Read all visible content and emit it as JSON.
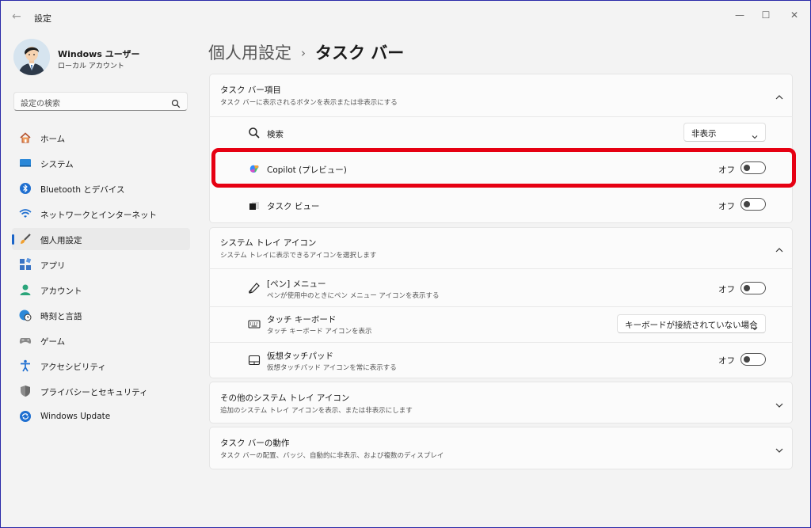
{
  "window": {
    "title": "設定",
    "back_glyph": "←",
    "min_glyph": "—",
    "max_glyph": "☐",
    "close_glyph": "✕"
  },
  "user": {
    "name": "Windows ユーザー",
    "type": "ローカル アカウント"
  },
  "search": {
    "placeholder": "設定の検索"
  },
  "sidebar": {
    "items": [
      {
        "label": "ホーム",
        "icon": "home-icon"
      },
      {
        "label": "システム",
        "icon": "system-icon"
      },
      {
        "label": "Bluetooth とデバイス",
        "icon": "bluetooth-icon"
      },
      {
        "label": "ネットワークとインターネット",
        "icon": "wifi-icon"
      },
      {
        "label": "個人用設定",
        "icon": "brush-icon",
        "active": true
      },
      {
        "label": "アプリ",
        "icon": "apps-icon"
      },
      {
        "label": "アカウント",
        "icon": "account-icon"
      },
      {
        "label": "時刻と言語",
        "icon": "globe-clock-icon"
      },
      {
        "label": "ゲーム",
        "icon": "gamepad-icon"
      },
      {
        "label": "アクセシビリティ",
        "icon": "accessibility-icon"
      },
      {
        "label": "プライバシーとセキュリティ",
        "icon": "shield-icon"
      },
      {
        "label": "Windows Update",
        "icon": "update-icon"
      }
    ]
  },
  "breadcrumb": {
    "parent": "個人用設定",
    "separator": "›",
    "current": "タスク バー"
  },
  "taskbar_items": {
    "title": "タスク バー項目",
    "subtitle": "タスク バーに表示されるボタンを表示または非表示にする",
    "search": {
      "label": "検索",
      "value": "非表示"
    },
    "copilot": {
      "label": "Copilot (プレビュー)",
      "state": "オフ"
    },
    "taskview": {
      "label": "タスク ビュー",
      "state": "オフ"
    }
  },
  "system_tray": {
    "title": "システム トレイ アイコン",
    "subtitle": "システム トレイに表示できるアイコンを選択します",
    "pen": {
      "label": "[ペン] メニュー",
      "sub": "ペンが使用中のときにペン メニュー アイコンを表示する",
      "state": "オフ"
    },
    "keyboard": {
      "label": "タッチ キーボード",
      "sub": "タッチ キーボード アイコンを表示",
      "value": "キーボードが接続されていない場合"
    },
    "touchpad": {
      "label": "仮想タッチパッド",
      "sub": "仮想タッチパッド アイコンを常に表示する",
      "state": "オフ"
    }
  },
  "other_tray": {
    "title": "その他のシステム トレイ アイコン",
    "subtitle": "追加のシステム トレイ アイコンを表示、または非表示にします"
  },
  "behaviors": {
    "title": "タスク バーの動作",
    "subtitle": "タスク バーの配置、バッジ、自動的に非表示、および複数のディスプレイ"
  },
  "colors": {
    "accent": "#1a64c8",
    "highlight": "#e60012"
  }
}
